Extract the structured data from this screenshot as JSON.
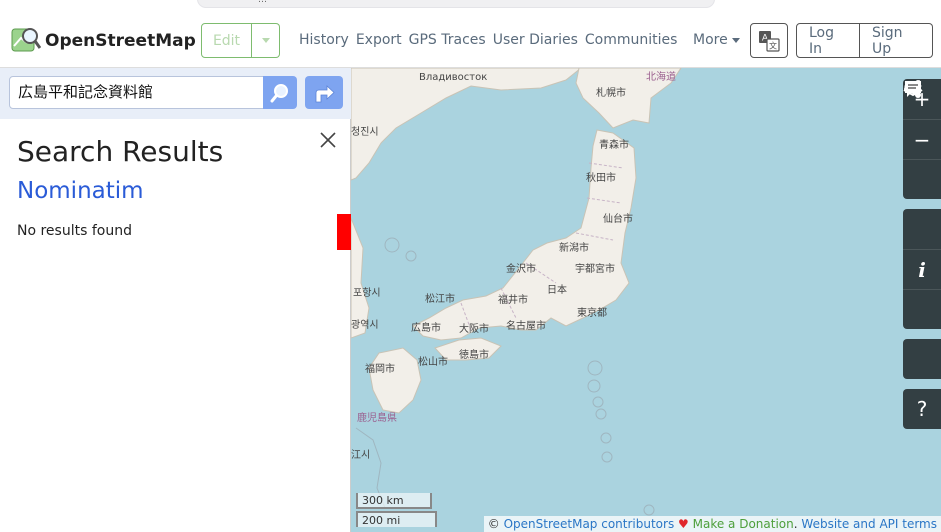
{
  "browser": {
    "url_fragment": "…"
  },
  "header": {
    "brand": "OpenStreetMap",
    "edit_label": "Edit",
    "nav": [
      "History",
      "Export",
      "GPS Traces",
      "User Diaries",
      "Communities"
    ],
    "more_label": "More",
    "login_label": "Log In",
    "signup_label": "Sign Up"
  },
  "sidebar": {
    "search_value": "広島平和記念資料館",
    "results_title": "Search Results",
    "provider": "Nominatim",
    "no_results": "No results found"
  },
  "map": {
    "labels": [
      {
        "name": "Владивосток",
        "cls": ""
      },
      {
        "name": "札幌市",
        "cls": ""
      },
      {
        "name": "北海道",
        "cls": "pref"
      },
      {
        "name": "청진시",
        "cls": ""
      },
      {
        "name": "青森市",
        "cls": ""
      },
      {
        "name": "秋田市",
        "cls": ""
      },
      {
        "name": "仙台市",
        "cls": ""
      },
      {
        "name": "新潟市",
        "cls": ""
      },
      {
        "name": "金沢市",
        "cls": ""
      },
      {
        "name": "宇都宮市",
        "cls": ""
      },
      {
        "name": "日本",
        "cls": ""
      },
      {
        "name": "福井市",
        "cls": ""
      },
      {
        "name": "松江市",
        "cls": ""
      },
      {
        "name": "東京都",
        "cls": ""
      },
      {
        "name": "포항시",
        "cls": ""
      },
      {
        "name": "名古屋市",
        "cls": ""
      },
      {
        "name": "広島市",
        "cls": ""
      },
      {
        "name": "大阪市",
        "cls": ""
      },
      {
        "name": "광역시",
        "cls": ""
      },
      {
        "name": "徳島市",
        "cls": ""
      },
      {
        "name": "松山市",
        "cls": ""
      },
      {
        "name": "福岡市",
        "cls": ""
      },
      {
        "name": "鹿児島県",
        "cls": "pref"
      },
      {
        "name": "江시",
        "cls": ""
      }
    ],
    "scale_km": "300 km",
    "scale_mi": "200 mi",
    "attribution": {
      "copyright": "©",
      "contributors": "OpenStreetMap contributors",
      "heart": "♥",
      "donate": "Make a Donation",
      "terms": "Website and API terms",
      "sep": "."
    },
    "controls": {
      "zoom_in": "+",
      "zoom_out": "−",
      "info": "i",
      "help": "?"
    }
  },
  "colors": {
    "water": "#aad3df",
    "land": "#f2efe9",
    "accent": "#7ebc6f",
    "link": "#2a5bd7"
  }
}
